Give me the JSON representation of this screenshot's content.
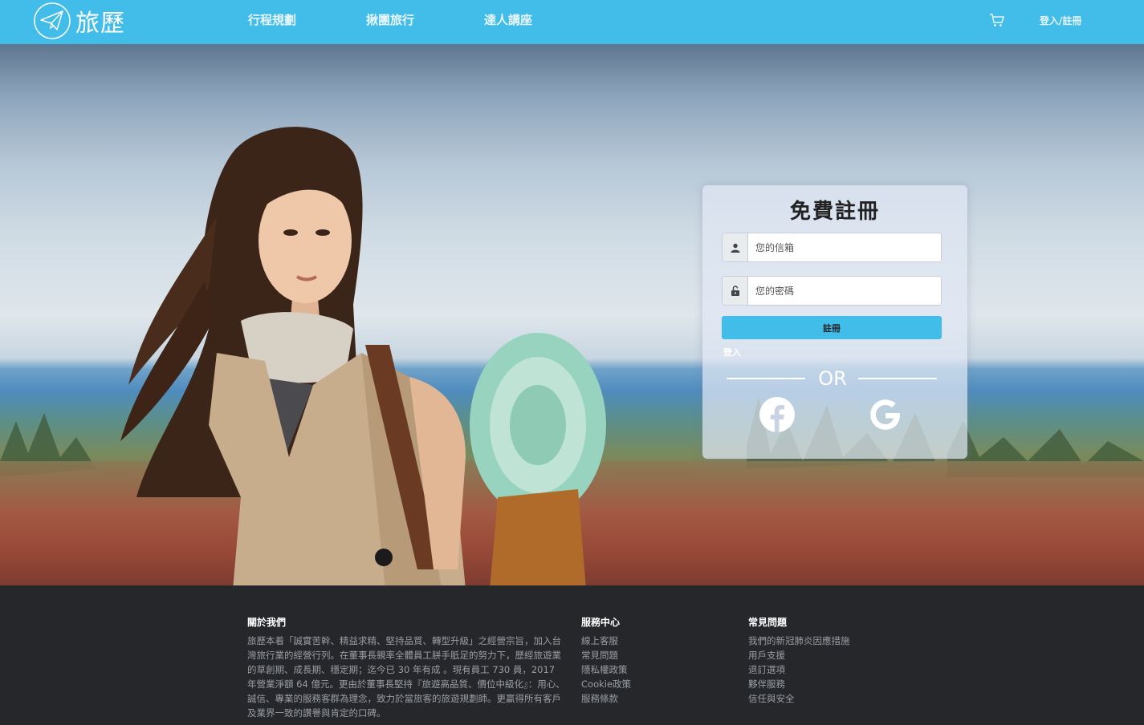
{
  "header": {
    "logo_text": "旅歷",
    "nav": [
      "行程規劃",
      "揪團旅行",
      "達人講座"
    ],
    "login_link": "登入/註冊"
  },
  "register": {
    "title": "免費註冊",
    "email_placeholder": "您的信箱",
    "password_placeholder": "您的密碼",
    "submit_label": "註冊",
    "login_label": "登入",
    "or_label": "OR"
  },
  "footer": {
    "about_title": "關於我們",
    "about_text": "旅歷本着「誠實苦幹、精益求精、堅持品質、轉型升級」之經營宗旨，加入台灣旅行業的經營行列。在董事長親率全體員工胼手胝足的努力下，歷經旅遊業的草創期、成長期、穩定期；迄今已 30 年有成 。現有員工 730 員，2017 年營業淨額 64 億元。更由於董事長堅持『旅遊高品質、價位中級化』：用心、誠信、專業的服務客群為理念，致力於當旅客的旅遊規劃師。更贏得所有客戶及業界一致的讚譽與肯定的口碑。",
    "service_title": "服務中心",
    "service_links": [
      "線上客服",
      "常見問題",
      "隱私權政策",
      "Cookie政策",
      "服務條款"
    ],
    "faq_title": "常見問題",
    "faq_links": [
      "我們的新冠肺炎因應措施",
      "用戶支援",
      "退訂選項",
      "夥伴服務",
      "信任與安全"
    ]
  },
  "colors": {
    "brand": "#42bce8",
    "footer_bg": "#25272b"
  }
}
